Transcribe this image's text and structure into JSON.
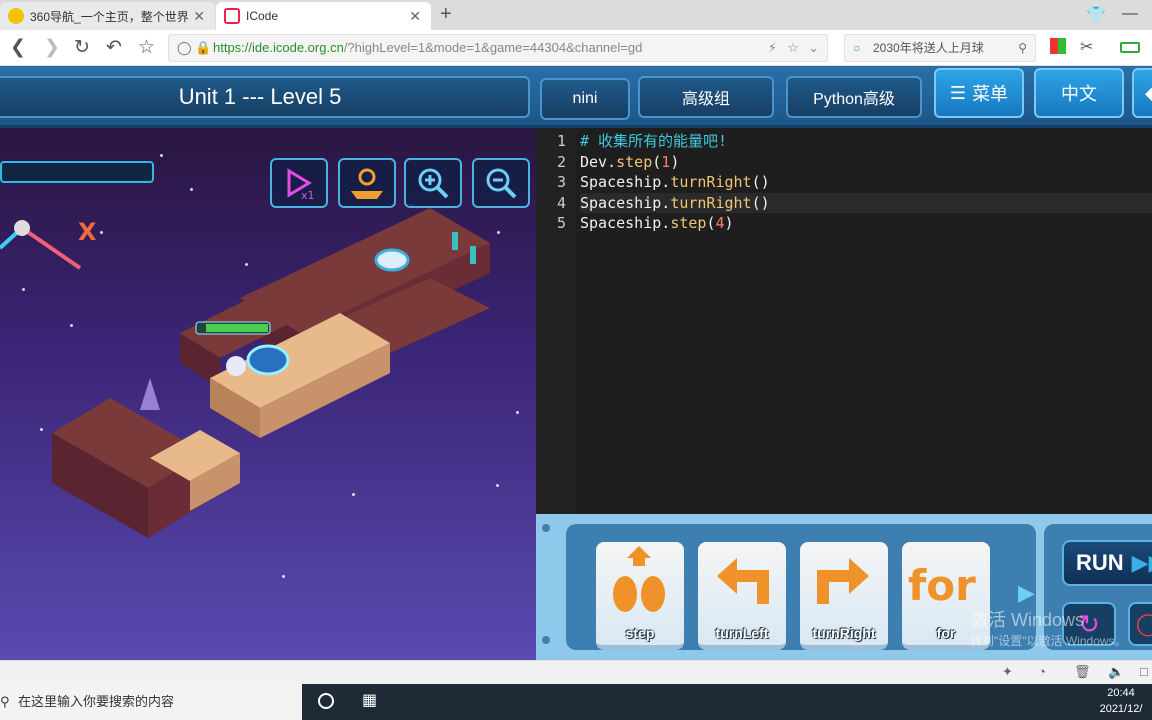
{
  "browser": {
    "tabs": [
      {
        "label": "360导航_一个主页，整个世界",
        "active": false
      },
      {
        "label": "ICode",
        "active": true
      }
    ],
    "url": {
      "scheme": "https://",
      "host": "ide.icode.org.cn",
      "path": "/?highLevel=1&mode=1&game=44304&channel=gd"
    },
    "search_text": "2030年将送人上月球"
  },
  "header": {
    "title": "Unit 1 --- Level 5",
    "user": "nini",
    "group": "高级组",
    "course": "Python高级",
    "menu": "菜单",
    "language": "中文"
  },
  "editor": {
    "lines": [
      {
        "n": "1",
        "parts": [
          {
            "t": "# 收集所有的能量吧!",
            "c": "cmt"
          }
        ]
      },
      {
        "n": "2",
        "parts": [
          {
            "t": "Dev.",
            "c": ""
          },
          {
            "t": "step",
            "c": "fn"
          },
          {
            "t": "(",
            "c": ""
          },
          {
            "t": "1",
            "c": "num"
          },
          {
            "t": ")",
            "c": ""
          }
        ]
      },
      {
        "n": "3",
        "parts": [
          {
            "t": "Spaceship.",
            "c": ""
          },
          {
            "t": "turnRight",
            "c": "fn"
          },
          {
            "t": "()",
            "c": ""
          }
        ]
      },
      {
        "n": "4",
        "parts": [
          {
            "t": "Spaceship.",
            "c": ""
          },
          {
            "t": "turnRight",
            "c": "fn"
          },
          {
            "t": "()",
            "c": ""
          }
        ]
      },
      {
        "n": "5",
        "parts": [
          {
            "t": "Spaceship.",
            "c": ""
          },
          {
            "t": "step",
            "c": "fn"
          },
          {
            "t": "(",
            "c": ""
          },
          {
            "t": "4",
            "c": "num"
          },
          {
            "t": ")",
            "c": ""
          }
        ]
      }
    ]
  },
  "palette": {
    "blocks": [
      {
        "label": "step",
        "icon": "step-footprints-icon"
      },
      {
        "label": "turnLeft",
        "icon": "turn-left-arrow-icon"
      },
      {
        "label": "turnRight",
        "icon": "turn-right-arrow-icon"
      },
      {
        "label": "for",
        "icon": "for-loop-icon"
      }
    ],
    "run_label": "RUN"
  },
  "watermark": {
    "line1": "激活 Windows",
    "line2": "转到\"设置\"以激活 Windows。"
  },
  "taskbar": {
    "search_placeholder": "在这里输入你要搜索的内容",
    "time": "20:44",
    "date": "2021/12/"
  },
  "colors": {
    "accent": "#2da4e6",
    "header": "#1d5688",
    "block_orange": "#f0922a"
  }
}
